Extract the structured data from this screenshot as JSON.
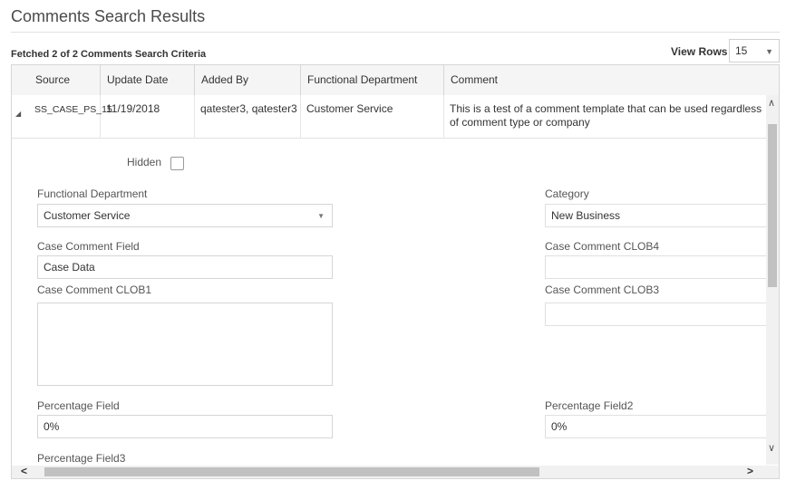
{
  "page": {
    "title": "Comments Search Results"
  },
  "toolbar": {
    "fetched_text": "Fetched 2 of 2 Comments Search Criteria",
    "view_rows_label": "View Rows",
    "view_rows_value": "15"
  },
  "table": {
    "headers": [
      "Source",
      "Update Date",
      "Added By",
      "Functional Department",
      "Comment"
    ],
    "row": {
      "source": "SS_CASE_PS_15",
      "update_date": "11/19/2018",
      "added_by": "qatester3, qatester3",
      "functional_department": "Customer Service",
      "comment": "This is a test of a comment template that can be used regardless of comment type or company"
    }
  },
  "detail": {
    "hidden_label": "Hidden",
    "functional_department_label": "Functional Department",
    "functional_department_value": "Customer Service",
    "category_label": "Category",
    "category_value": "New Business",
    "case_comment_field_label": "Case Comment Field",
    "case_comment_field_value": "Case Data",
    "case_comment_clob4_label": "Case Comment CLOB4",
    "case_comment_clob4_value": "",
    "case_comment_clob1_label": "Case Comment CLOB1",
    "case_comment_clob3_label": "Case Comment CLOB3",
    "percentage_field_label": "Percentage Field",
    "percentage_field_value": "0%",
    "percentage_field2_label": "Percentage Field2",
    "percentage_field2_value": "0%",
    "percentage_field3_label": "Percentage Field3"
  }
}
